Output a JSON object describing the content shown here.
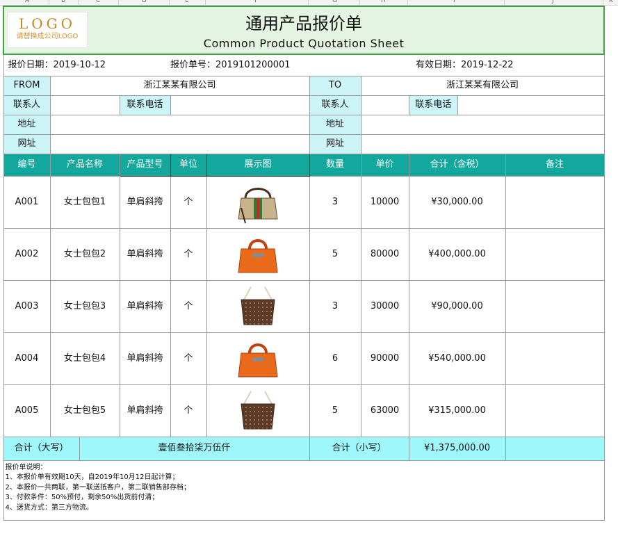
{
  "column_letters": [
    "A",
    "B",
    "C",
    "D",
    "E",
    "F",
    "G",
    "H",
    "I",
    "J",
    "K",
    "L"
  ],
  "logo": {
    "main": "LOGO",
    "sub": "请替换成公司LOGO"
  },
  "title": {
    "cn": "通用产品报价单",
    "en": "Common Product Quotation Sheet"
  },
  "info": {
    "quote_date": "报价日期：2019-10-12",
    "quote_no": "报价单号：2019101200001",
    "valid_date": "有效日期：2019-12-22"
  },
  "from_label": "FROM",
  "from_company": "浙江某某有限公司",
  "to_label": "TO",
  "to_company": "浙江某某有限公司",
  "contact_label": "联系人",
  "phone_label": "联系电话",
  "address_label": "地址",
  "website_label": "网址",
  "columns": [
    "编号",
    "产品名称",
    "产品型号",
    "单位",
    "展示图",
    "数量",
    "单价",
    "合计（含税）",
    "备注"
  ],
  "products": [
    {
      "id": "A001",
      "name": "女士包包1",
      "model": "单肩斜挎",
      "unit": "个",
      "image": "striped-handbag",
      "qty": "3",
      "price": "10000",
      "total": "¥30,000.00",
      "note": ""
    },
    {
      "id": "A002",
      "name": "女士包包2",
      "model": "单肩斜挎",
      "unit": "个",
      "image": "orange-tote",
      "qty": "5",
      "price": "80000",
      "total": "¥400,000.00",
      "note": ""
    },
    {
      "id": "A003",
      "name": "女士包包3",
      "model": "单肩斜挎",
      "unit": "个",
      "image": "brown-monogram-tote",
      "qty": "3",
      "price": "30000",
      "total": "¥90,000.00",
      "note": ""
    },
    {
      "id": "A004",
      "name": "女士包包4",
      "model": "单肩斜挎",
      "unit": "个",
      "image": "orange-tote",
      "qty": "6",
      "price": "90000",
      "total": "¥540,000.00",
      "note": ""
    },
    {
      "id": "A005",
      "name": "女士包包5",
      "model": "单肩斜挎",
      "unit": "个",
      "image": "brown-monogram-tote",
      "qty": "5",
      "price": "63000",
      "total": "¥315,000.00",
      "note": ""
    }
  ],
  "total": {
    "upper_label": "合计（大写）",
    "upper_value": "壹佰叁拾柒万伍仟",
    "lower_label": "合计（小写）",
    "lower_value": "¥1,375,000.00"
  },
  "notes": {
    "heading": "报价单说明：",
    "lines": [
      "1、本报价单有效期10天，自2019年10月12日起计算；",
      "2、本报价一共两联，第一联送抵客户，第二联销售部存档；",
      "3、付款条件：50%预付，剩余50%出货前付清；",
      "4、送货方式：第三方物流。"
    ]
  },
  "colors": {
    "header_bg": "#13a89e",
    "label_bg": "#ccf5f7",
    "total_bg": "#9ef7fb",
    "title_bg": "#e5f5e3",
    "title_border": "#43a047",
    "logo_color": "#c58720"
  }
}
